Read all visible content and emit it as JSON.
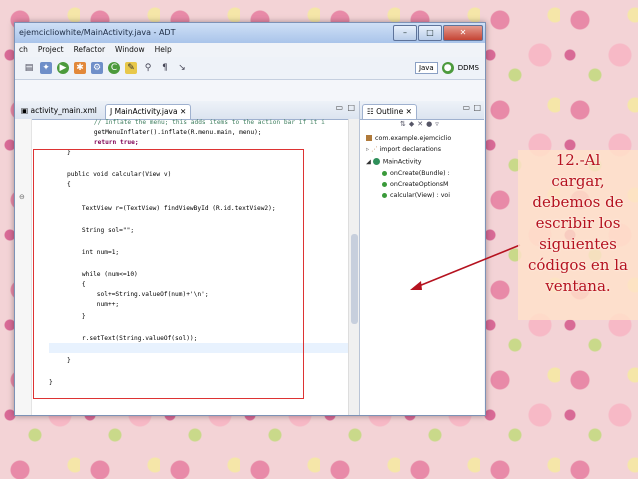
{
  "window": {
    "title": "ejemcicliowhite/MainActivity.java - ADT",
    "buttons": [
      "–",
      "□",
      "✕"
    ]
  },
  "menu": [
    "ch",
    "Project",
    "Refactor",
    "Window",
    "Help"
  ],
  "perspectives": {
    "java": "Java",
    "ddms": "DDMS"
  },
  "editor": {
    "tabs": [
      "activity_main.xml",
      "MainActivity.java"
    ],
    "code": [
      "    // Inflate the menu; this adds items to the action bar if it i",
      "    getMenuInflater().inflate(R.menu.main, menu);",
      "    return true;",
      "}",
      "public void calcular(View v)",
      "{",
      "    TextView r=(TextView) findViewById (R.id.textView2);",
      "    String sol=\"\";",
      "    int num=1;",
      "    while (num<=10)",
      "    {",
      "        sol+=String.valueOf(num)+'\\n';",
      "        num++;",
      "    }",
      "    r.setText(String.valueOf(sol));",
      "}",
      "}"
    ]
  },
  "outline": {
    "title": "Outline",
    "items": [
      "com.example.ejemciclio",
      "import declarations",
      "MainActivity",
      "onCreate(Bundle) :",
      "onCreateOptionsM",
      "calcular(View) : voi"
    ]
  },
  "callout": {
    "lines": [
      "12.-Al",
      "cargar,",
      "debemos de",
      "escribir los",
      "siguientes",
      "códigos en la",
      "ventana."
    ]
  },
  "colors": {
    "accent": "#b5121f",
    "box": "#dd3333"
  }
}
